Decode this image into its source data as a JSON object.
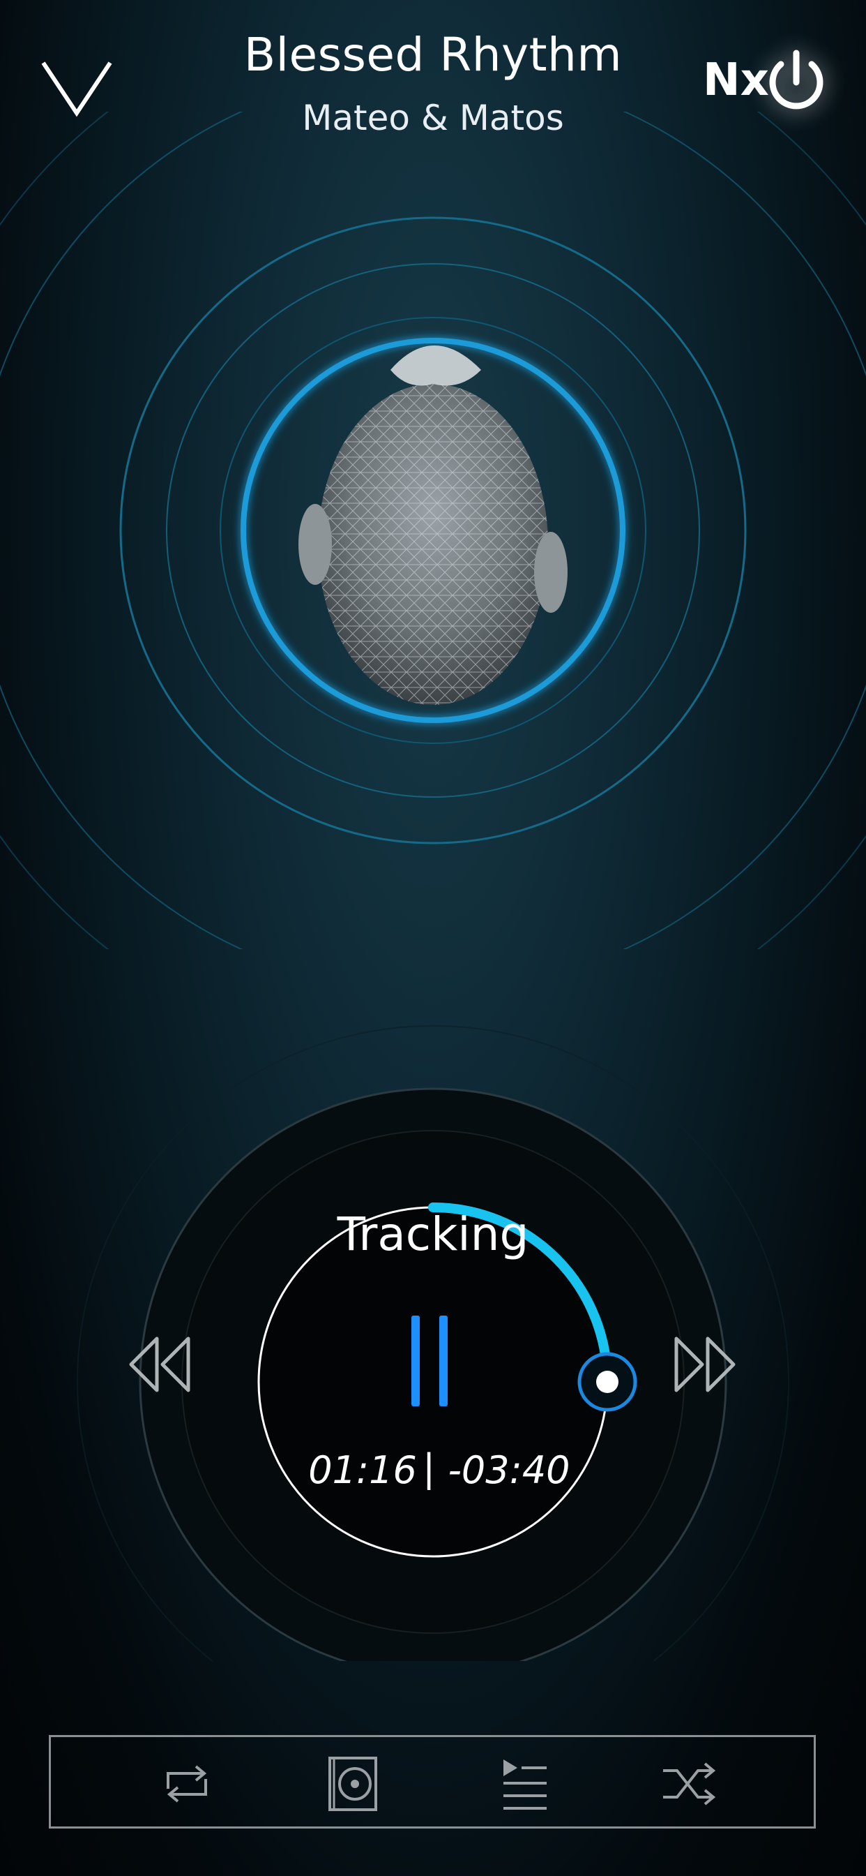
{
  "header": {
    "title": "Blessed Rhythm",
    "artist": "Mateo & Matos",
    "mode_label": "Nx",
    "icons": {
      "collapse": "chevron-down-icon",
      "power": "power-icon"
    }
  },
  "visual": {
    "icon": "head-wireframe-icon",
    "accent_color": "#1a9bd8"
  },
  "player": {
    "status": "Tracking",
    "elapsed": "01:16",
    "separator": "|",
    "remaining": "-03:40",
    "progress_fraction": 0.25,
    "progress_color": "#18c4ef",
    "icons": {
      "pause": "pause-icon",
      "rewind": "rewind-icon",
      "forward": "fast-forward-icon"
    }
  },
  "bottom_bar": {
    "items": [
      {
        "icon": "repeat-icon"
      },
      {
        "icon": "album-icon"
      },
      {
        "icon": "playlist-icon"
      },
      {
        "icon": "shuffle-icon"
      }
    ]
  }
}
